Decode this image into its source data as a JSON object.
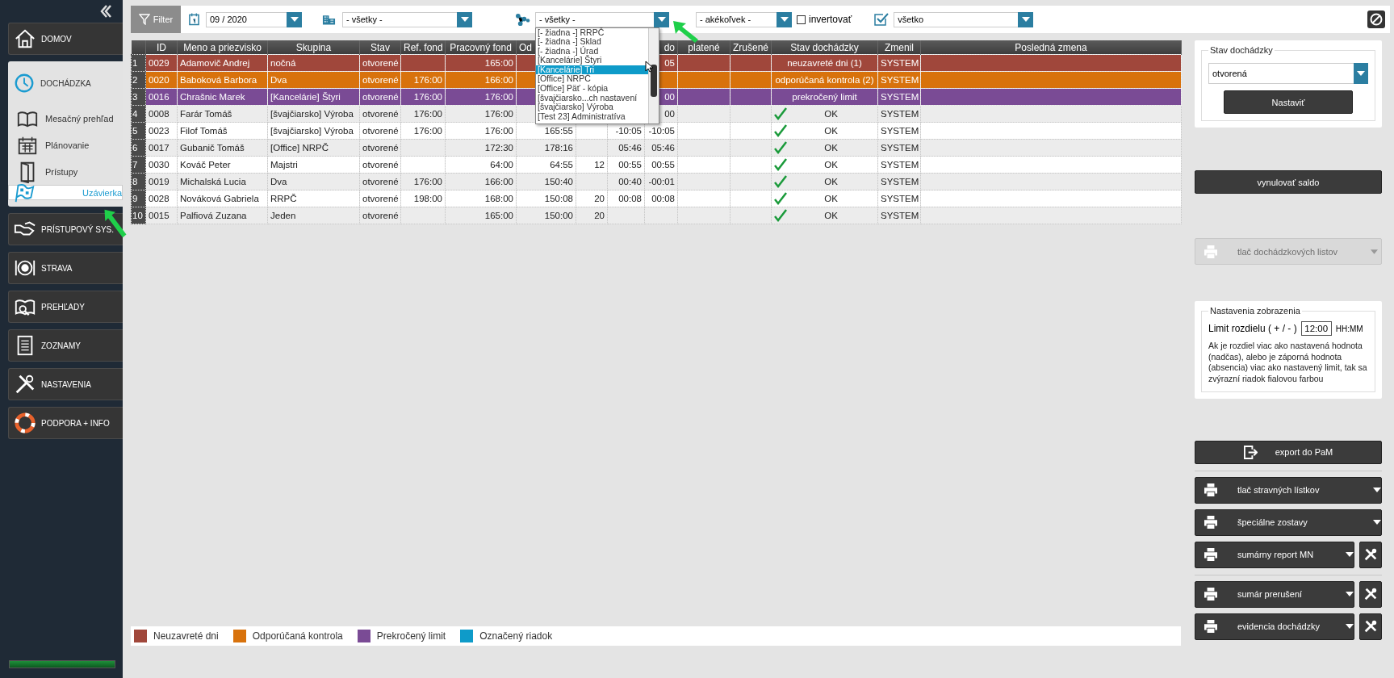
{
  "sidebar": {
    "items": [
      {
        "label": "DOMOV"
      },
      {
        "label": "DOCHÁDZKA",
        "expanded": true,
        "children": [
          {
            "label": "Mesačný prehľad",
            "selected": false
          },
          {
            "label": "Plánovanie",
            "selected": false
          },
          {
            "label": "Prístupy",
            "selected": false
          },
          {
            "label": "Uzávierka",
            "selected": true
          }
        ]
      },
      {
        "label": "PRÍSTUPOVÝ SYS."
      },
      {
        "label": "STRAVA"
      },
      {
        "label": "PREHĽADY"
      },
      {
        "label": "ZOZNAMY"
      },
      {
        "label": "NASTAVENIA"
      },
      {
        "label": "PODPORA + INFO"
      }
    ],
    "progress": {
      "level": 1
    }
  },
  "toolbar": {
    "filter_button": "Filter",
    "month": {
      "value": "09 / 2020"
    },
    "location": {
      "value": "- všetky -"
    },
    "group": {
      "value": "- všetky -",
      "expanded": true,
      "options": [
        {
          "label": "[- žiadna -] RRPČ",
          "selected": false
        },
        {
          "label": "[- žiadna -] Sklad",
          "selected": false
        },
        {
          "label": "[- žiadna -] Úrad",
          "selected": false
        },
        {
          "label": "[Kancelárie] Štyri",
          "selected": false
        },
        {
          "label": "[Kancelárie] Tri",
          "selected": true
        },
        {
          "label": "[Office] NRPČ",
          "selected": false
        },
        {
          "label": "[Office] Päť - kópia",
          "selected": false
        },
        {
          "label": "[švajčiarsko...ch nastavení",
          "selected": false
        },
        {
          "label": "[švajčiarsko] Výroba",
          "selected": false
        },
        {
          "label": "[Test 23] Administratíva",
          "selected": false
        }
      ]
    },
    "condition": {
      "value": "- akékoľvek -"
    },
    "invert": {
      "label": "invertovať",
      "checked": false
    },
    "status": {
      "value": "všetko"
    }
  },
  "table": {
    "columns": [
      {
        "label": "ID"
      },
      {
        "label": "Meno a priezvisko"
      },
      {
        "label": "Skupina"
      },
      {
        "label": "Stav"
      },
      {
        "label": "Ref. fond"
      },
      {
        "label": "Pracovný fond"
      },
      {
        "label": "Od"
      },
      {},
      {},
      {
        "label": "do"
      },
      {
        "label": "platené"
      },
      {
        "label": "Zrušené"
      },
      {
        "label": "Stav dochádzky"
      },
      {
        "label": "Zmenil"
      },
      {
        "label": "Posledná zmena"
      }
    ],
    "rows": [
      {
        "number": "1",
        "color": "#a0473b",
        "checked": false,
        "cells": [
          "0029",
          "Adamovič Andrej",
          "nočná",
          "otvorené",
          null,
          "165:00",
          null,
          null,
          null,
          "05",
          null,
          null,
          "neuzavreté dni (1)",
          "SYSTEM",
          null
        ]
      },
      {
        "number": "2",
        "color": "#d8720c",
        "checked": false,
        "cells": [
          "0020",
          "Baboková Barbora",
          "Dva",
          "otvorené",
          "176:00",
          "166:00",
          null,
          null,
          null,
          null,
          null,
          null,
          "odporúčaná kontrola (2)",
          "SYSTEM",
          null
        ]
      },
      {
        "number": "3",
        "color": "#7a4b95",
        "checked": false,
        "cells": [
          "0016",
          "Chrašnic Marek",
          "[Kancelárie] Štyri",
          "otvorené",
          "176:00",
          "176:00",
          null,
          null,
          null,
          "00",
          null,
          null,
          "prekročený limit",
          "SYSTEM",
          null
        ]
      },
      {
        "number": "4",
        "checked": true,
        "cells": [
          "0008",
          "Farár Tomáš",
          "[švajčiarsko] Výroba",
          "otvorené",
          "176:00",
          "176:00",
          null,
          null,
          null,
          "00",
          null,
          null,
          "OK",
          "SYSTEM",
          null
        ]
      },
      {
        "number": "5",
        "checked": true,
        "cells": [
          "0023",
          "Filof Tomáš",
          "[švajčiarsko] Výroba",
          "otvorené",
          "176:00",
          "176:00",
          "165:55",
          null,
          "-10:05",
          "-10:05",
          null,
          null,
          "OK",
          "SYSTEM",
          null
        ]
      },
      {
        "number": "6",
        "checked": true,
        "cells": [
          "0017",
          "Gubanič Tomáš",
          "[Office] NRPČ",
          "otvorené",
          null,
          "172:30",
          "178:16",
          null,
          "05:46",
          "05:46",
          null,
          null,
          "OK",
          "SYSTEM",
          null
        ]
      },
      {
        "number": "7",
        "checked": true,
        "cells": [
          "0030",
          "Kováč Peter",
          "Majstri",
          "otvorené",
          null,
          "64:00",
          "64:55",
          "12",
          "00:55",
          "00:55",
          null,
          null,
          "OK",
          "SYSTEM",
          null
        ]
      },
      {
        "number": "8",
        "checked": true,
        "cells": [
          "0019",
          "Michalská Lucia",
          "Dva",
          "otvorené",
          "176:00",
          "166:00",
          "150:40",
          null,
          "00:40",
          "-00:01",
          null,
          null,
          "OK",
          "SYSTEM",
          null
        ]
      },
      {
        "number": "9",
        "checked": true,
        "cells": [
          "0028",
          "Nováková Gabriela",
          "RRPČ",
          "otvorené",
          "198:00",
          "168:00",
          "150:08",
          "20",
          "00:08",
          "00:08",
          null,
          null,
          "OK",
          "SYSTEM",
          null
        ]
      },
      {
        "number": "10",
        "checked": true,
        "cells": [
          "0015",
          "Palfiová Zuzana",
          "Jeden",
          "otvorené",
          null,
          "165:00",
          "150:00",
          "20",
          null,
          null,
          null,
          null,
          "OK",
          "SYSTEM",
          null
        ]
      }
    ]
  },
  "legend": [
    {
      "label": "Neuzavreté dni",
      "color": "#a0473b"
    },
    {
      "label": "Odporúčaná kontrola",
      "color": "#d8720c"
    },
    {
      "label": "Prekročený limit",
      "color": "#7a4b95"
    },
    {
      "label": "Označený riadok",
      "color": "#0e9bc9"
    }
  ],
  "right_panel": {
    "status_card": {
      "legend": "Stav dochádzky",
      "value": "otvorená",
      "button": "Nastaviť"
    },
    "reset_button": "vynulovať saldo",
    "print_sheets": {
      "label": "tlač dochádzkových listov",
      "disabled": true
    },
    "display_settings": {
      "legend": "Nastavenia zobrazenia",
      "limit_label": "Limit rozdielu ( + / - )",
      "limit_value": "12:00",
      "unit": "HH:MM",
      "note": "Ak je rozdiel viac ako nastavená hodnota (nadčas), alebo je záporná hodnota (absencia) viac ako nastavený limit, tak sa zvýrazní riadok fialovou farbou"
    },
    "action_groups": [
      [
        {
          "kind": "button",
          "label": "export do PaM",
          "tool": false
        }
      ],
      [
        {
          "kind": "menu",
          "label": "tlač stravných lístkov",
          "tool": false
        },
        {
          "kind": "menu",
          "label": "špeciálne zostavy",
          "tool": false
        },
        {
          "kind": "menu",
          "label": "sumárny report MN",
          "tool": true
        }
      ],
      [
        {
          "kind": "menu",
          "label": "sumár prerušení",
          "tool": true
        },
        {
          "kind": "menu",
          "label": "evidencia dochádzky",
          "tool": true
        }
      ]
    ]
  }
}
